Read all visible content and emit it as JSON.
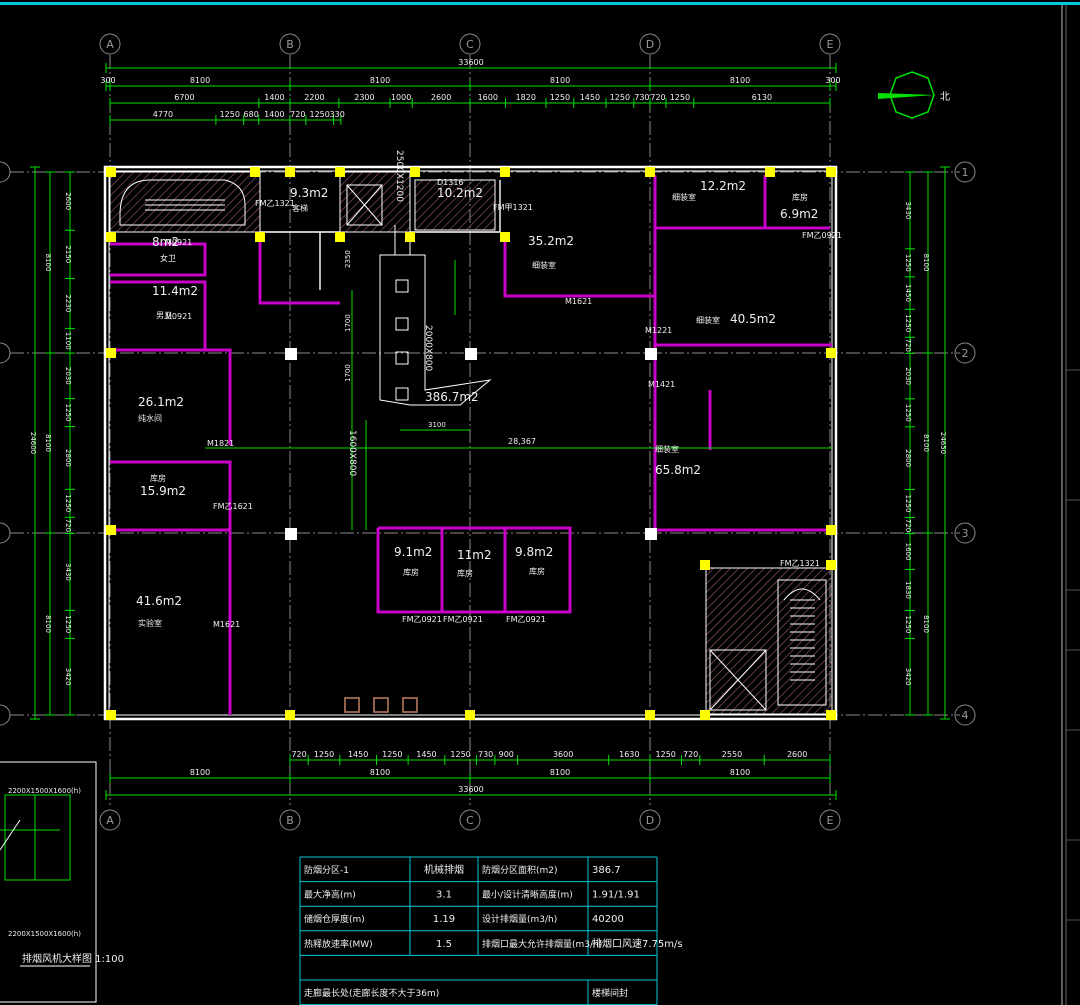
{
  "colors": {
    "background": "#000000",
    "wall": "#ffffff",
    "partition": "#c800c8",
    "column": "#ffff00",
    "dimension": "#00e000",
    "grid_axis": "#8a8a8a",
    "hatch": "#a06060",
    "border": "#00c8d8",
    "text": "#f0f0f0"
  },
  "north": {
    "label": "北"
  },
  "axes": {
    "columns": [
      "A",
      "B",
      "C",
      "D",
      "E"
    ],
    "rows": [
      "1",
      "2",
      "3",
      "4"
    ]
  },
  "dimensions": {
    "top_total": "33600",
    "top_spans": [
      "300",
      "8100",
      "8100",
      "8100",
      "8100",
      "300"
    ],
    "top_row2": [
      "6700",
      "1400",
      "2200",
      "2300",
      "1000",
      "2600",
      "1600",
      "1820",
      "1250",
      "1450",
      "1250",
      "730",
      "720",
      "1250",
      "6130"
    ],
    "top_row3": [
      "4770",
      "1250",
      "680",
      "1400",
      "720",
      "1250",
      "330"
    ],
    "bottom_row1": [
      "720",
      "1250",
      "1450",
      "1250",
      "1450",
      "1250",
      "730",
      "900",
      "3600",
      "1630",
      "1250",
      "720",
      "2550",
      "2600"
    ],
    "bottom_spans": [
      "8100",
      "8100",
      "8100",
      "8100"
    ],
    "bottom_total": "33600",
    "left_total": "24600",
    "left_spans": [
      "8100",
      "8100",
      "8100"
    ],
    "left_row": [
      "2600",
      "2150",
      "2230",
      "1100",
      "2030",
      "1250",
      "2800",
      "1250",
      "720",
      "3430",
      "1250",
      "3420"
    ],
    "right_total": "24650",
    "right_spans": [
      "8100",
      "8100",
      "8100"
    ],
    "right_row": [
      "3430",
      "1250",
      "1450",
      "1250",
      "720",
      "2030",
      "1250",
      "2800",
      "1250",
      "720",
      "1600",
      "1830",
      "1250",
      "3420"
    ]
  },
  "rooms": [
    {
      "area": "9.3m2",
      "name": "客梯"
    },
    {
      "area": "10.2m2",
      "name": "D1316"
    },
    {
      "area": "8m2",
      "name": "女卫"
    },
    {
      "area": "11.4m2",
      "name": "男卫"
    },
    {
      "area": "35.2m2",
      "name": "细装室"
    },
    {
      "area": "12.2m2",
      "name": "细装室"
    },
    {
      "area": "6.9m2",
      "name": "库房"
    },
    {
      "area": "40.5m2",
      "name": "细装室"
    },
    {
      "area": "26.1m2",
      "name": "纯水间"
    },
    {
      "area": "386.7m2",
      "name": ""
    },
    {
      "area": "15.9m2",
      "name": "库房"
    },
    {
      "area": "65.8m2",
      "name": "细装室"
    },
    {
      "area": "41.6m2",
      "name": "实验室"
    },
    {
      "area": "9.1m2",
      "name": "库房"
    },
    {
      "area": "11m2",
      "name": "库房"
    },
    {
      "area": "9.8m2",
      "name": "库房"
    }
  ],
  "doors": [
    "FM乙1321",
    "FM甲1321",
    "M0921",
    "M0921",
    "M1621",
    "M1221",
    "FM乙0921",
    "M1421",
    "M1821",
    "FM乙1621",
    "M1621",
    "FM乙0921",
    "FM乙0921",
    "FM乙0921",
    "FM乙1321"
  ],
  "annotations": {
    "duct_top": "2500X1200",
    "duct_mid": "2000X800",
    "duct_vertical": "1600X800",
    "dim_3100": "3100",
    "dim_28367": "28,367",
    "dim_1700a": "1700",
    "dim_1700b": "1700",
    "dim_2350": "2350"
  },
  "legend": {
    "note1": "2200X1500X1600(h)",
    "note2": "2200X1500X1600(h)",
    "caption": "排烟风机大样图 1:100"
  },
  "table": {
    "rows": [
      [
        "防烟分区-1",
        "机械排烟",
        "防烟分区面积(m2)",
        "386.7"
      ],
      [
        "最大净高(m)",
        "3.1",
        "最小/设计清晰高度(m)",
        "1.91/1.91"
      ],
      [
        "储烟仓厚度(m)",
        "1.19",
        "设计排烟量(m3/h)",
        "40200"
      ],
      [
        "热释放速率(MW)",
        "1.5",
        "排烟口最大允许排烟量(m3/h)",
        "排烟口风速7.75m/s"
      ]
    ],
    "last_row": [
      "走廊最长处(走廊长度不大于36m)",
      "",
      "楼梯间封"
    ]
  }
}
